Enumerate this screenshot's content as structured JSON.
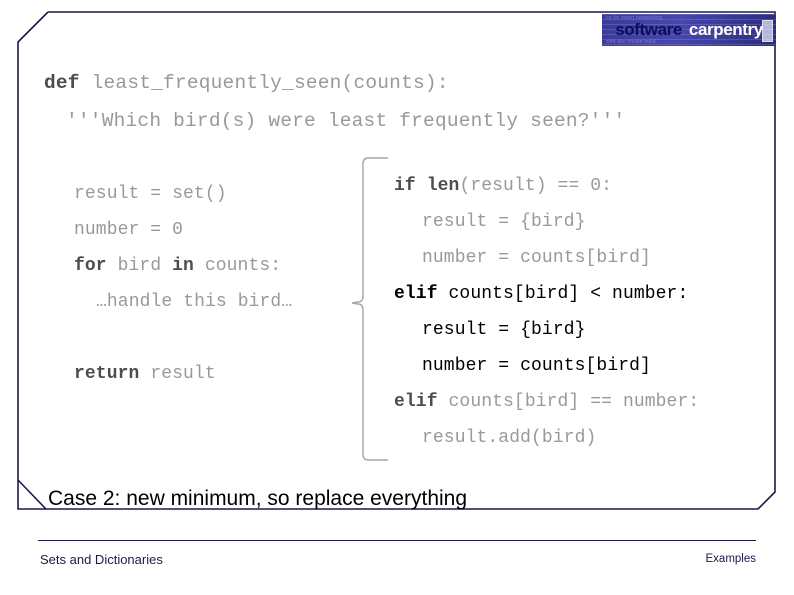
{
  "slide": {
    "border_color": "#1a1a4d",
    "background": "#ffffff"
  },
  "logo": {
    "word_one": "software",
    "word_two": "carpentry",
    "ghost_top": "cs for insert networking",
    "ghost_bottom": "with doc create build",
    "background_color": "#2f2f86",
    "word_one_color": "#0d0d5c",
    "word_two_color": "#ffffff"
  },
  "code": {
    "signature": {
      "keyword": "def",
      "rest": " least_frequently_seen(counts):"
    },
    "docstring": "'''Which bird(s) were least frequently seen?'''",
    "left_block": [
      {
        "indent": 0,
        "parts": [
          {
            "t": "result = set()",
            "kw": false
          }
        ]
      },
      {
        "indent": 0,
        "parts": [
          {
            "t": "number = 0",
            "kw": false
          }
        ]
      },
      {
        "indent": 0,
        "parts": [
          {
            "t": "for",
            "kw": true
          },
          {
            "t": " bird ",
            "kw": false
          },
          {
            "t": "in",
            "kw": true
          },
          {
            "t": " counts:",
            "kw": false
          }
        ]
      },
      {
        "indent": 1,
        "parts": [
          {
            "t": "…handle this bird…",
            "kw": false
          }
        ]
      },
      {
        "indent": 0,
        "parts": [
          {
            "t": "",
            "kw": false
          }
        ]
      },
      {
        "indent": 0,
        "parts": [
          {
            "t": "return",
            "kw": true
          },
          {
            "t": " result",
            "kw": false
          }
        ]
      }
    ],
    "right_block": [
      {
        "indent": 0,
        "highlight": false,
        "parts": [
          {
            "t": "if",
            "kw": true
          },
          {
            "t": " ",
            "kw": false
          },
          {
            "t": "len",
            "kw": true
          },
          {
            "t": "(result) == 0:",
            "kw": false
          }
        ]
      },
      {
        "indent": 1,
        "highlight": false,
        "parts": [
          {
            "t": "result = {bird}",
            "kw": false
          }
        ]
      },
      {
        "indent": 1,
        "highlight": false,
        "parts": [
          {
            "t": "number = counts[bird]",
            "kw": false
          }
        ]
      },
      {
        "indent": 0,
        "highlight": true,
        "parts": [
          {
            "t": "elif",
            "kw": true
          },
          {
            "t": " counts[bird] < number:",
            "kw": false
          }
        ]
      },
      {
        "indent": 1,
        "highlight": true,
        "parts": [
          {
            "t": "result = {bird}",
            "kw": false
          }
        ]
      },
      {
        "indent": 1,
        "highlight": true,
        "parts": [
          {
            "t": "number = counts[bird]",
            "kw": false
          }
        ]
      },
      {
        "indent": 0,
        "highlight": false,
        "parts": [
          {
            "t": "elif",
            "kw": true
          },
          {
            "t": " counts[bird] == number:",
            "kw": false
          }
        ]
      },
      {
        "indent": 1,
        "highlight": false,
        "parts": [
          {
            "t": "result.add(bird)",
            "kw": false
          }
        ]
      }
    ]
  },
  "caption": "Case 2: new minimum, so replace everything",
  "footer": {
    "left": "Sets and Dictionaries",
    "right": "Examples",
    "color": "#1a1a4d"
  }
}
